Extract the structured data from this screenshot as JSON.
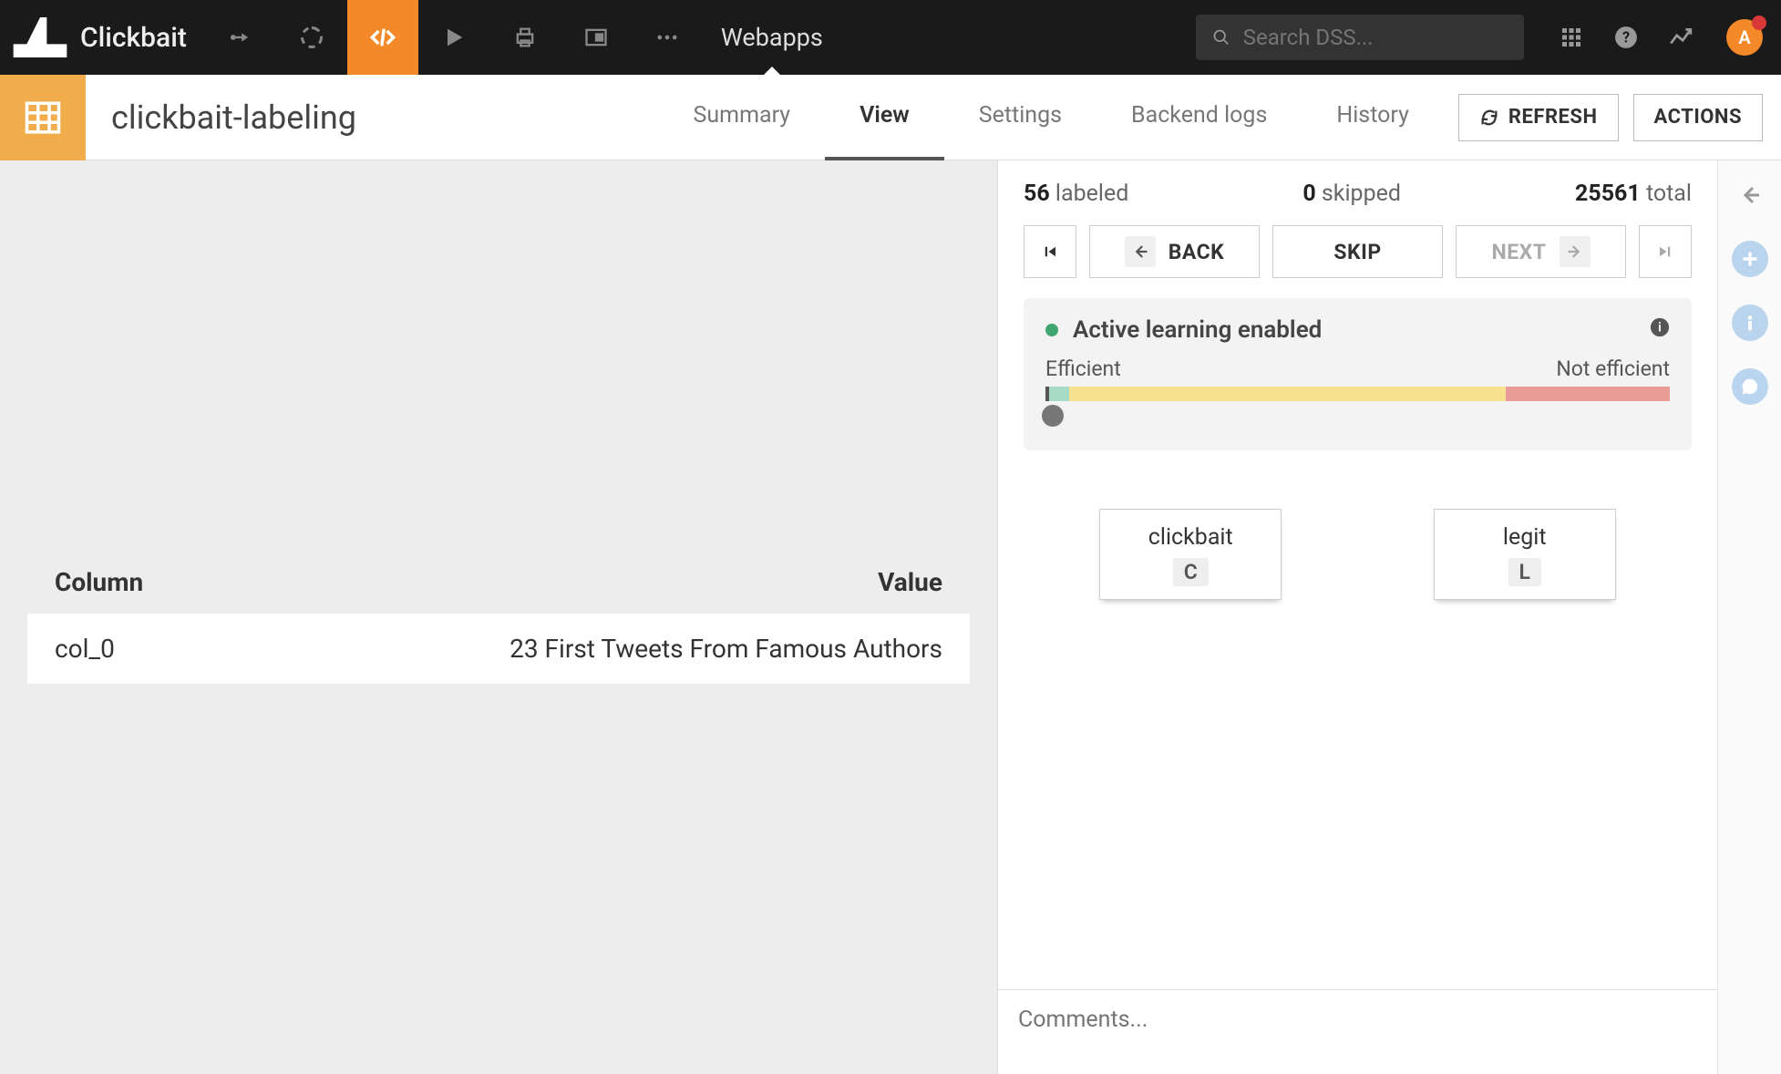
{
  "topnav": {
    "project_name": "Clickbait",
    "tab_label": "Webapps",
    "search_placeholder": "Search DSS...",
    "avatar_letter": "A"
  },
  "secondbar": {
    "title": "clickbait-labeling",
    "tabs": {
      "summary": "Summary",
      "view": "View",
      "settings": "Settings",
      "backend_logs": "Backend logs",
      "history": "History"
    },
    "refresh_label": "REFRESH",
    "actions_label": "ACTIONS"
  },
  "data_table": {
    "col_header": "Column",
    "val_header": "Value",
    "rows": [
      {
        "column": "col_0",
        "value": "23 First Tweets From Famous Authors"
      }
    ]
  },
  "stats": {
    "labeled_count": "56",
    "labeled_word": "labeled",
    "skipped_count": "0",
    "skipped_word": "skipped",
    "total_count": "25561",
    "total_word": "total"
  },
  "nav": {
    "back": "BACK",
    "skip": "SKIP",
    "next": "NEXT"
  },
  "active_learning": {
    "title": "Active learning enabled",
    "left_label": "Efficient",
    "right_label": "Not efficient"
  },
  "labels": {
    "option1": {
      "name": "clickbait",
      "key": "C"
    },
    "option2": {
      "name": "legit",
      "key": "L"
    }
  },
  "comments_placeholder": "Comments..."
}
